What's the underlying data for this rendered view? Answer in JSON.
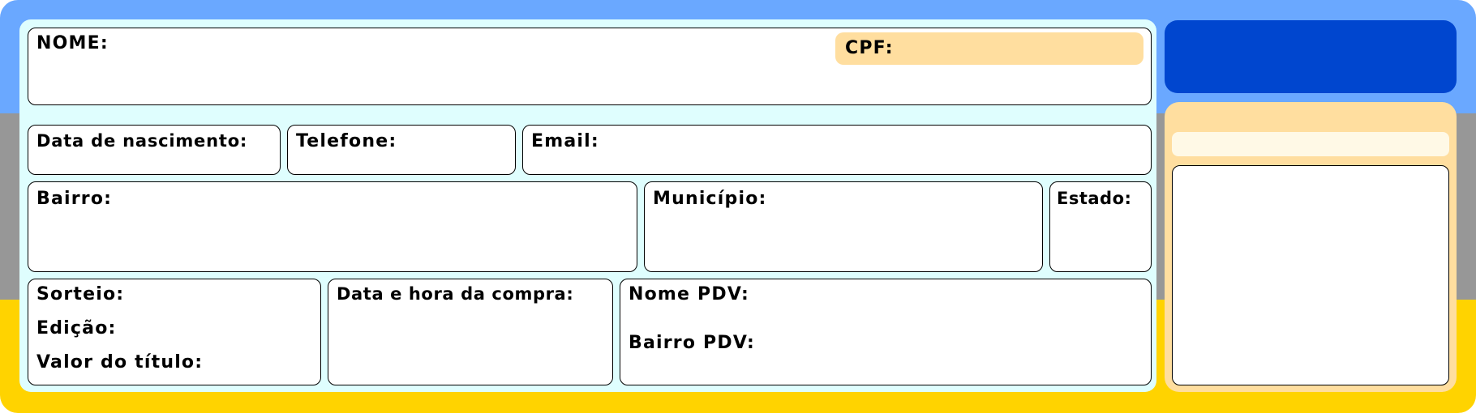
{
  "form": {
    "nome": "NOME:",
    "cpf": "CPF:",
    "data_nascimento": "Data de nascimento:",
    "telefone": "Telefone:",
    "email": "Email:",
    "bairro": "Bairro:",
    "municipio": "Município:",
    "estado": "Estado:",
    "sorteio": "Sorteio:",
    "edicao": "Edição:",
    "valor_titulo": "Valor do título:",
    "data_hora_compra": "Data e hora da compra:",
    "nome_pdv": "Nome PDV:",
    "bairro_pdv": "Bairro PDV:"
  },
  "colors": {
    "band_blue": "#6aa8ff",
    "band_gray": "#979797",
    "band_yellow": "#ffd300",
    "form_background": "#dffefe",
    "cpf_highlight": "#ffde9f",
    "side_header": "#0046cf",
    "side_panel": "#ffde9f"
  }
}
